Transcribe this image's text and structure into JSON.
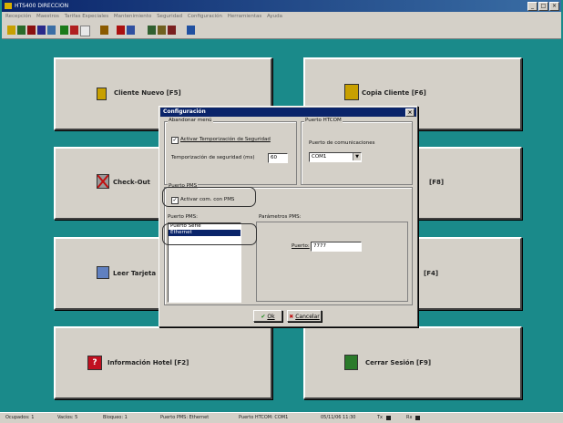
{
  "window": {
    "title": "HTS400 DIRECCION",
    "buttons": [
      "_",
      "□",
      "×"
    ]
  },
  "menu": [
    "Recepción",
    "Maestros",
    "Tarifas Especiales",
    "Mantenimiento",
    "Seguridad",
    "Configuración",
    "Herramientas",
    "Ayuda"
  ],
  "tiles": {
    "cliente_nuevo": "Cliente Nuevo   [F5]",
    "copia_cliente": "Copia Cliente   [F6]",
    "check_out": "Check-Out",
    "f8": "[F8]",
    "leer_tarjeta": "Leer Tarjeta",
    "f4": "[F4]",
    "informacion_hotel": "Información Hotel   [F2]",
    "cerrar_sesion": "Cerrar Sesión   [F9]"
  },
  "dialog": {
    "title": "Configuración",
    "close": "×",
    "abandonar": {
      "label": "Abandonar menú",
      "checkbox_label": "Activar Temporización de Seguridad",
      "timeout_label": "Temporización de seguridad (ms)",
      "timeout_value": "60"
    },
    "htcom": {
      "label": "Puerto HTCOM",
      "port_label": "Puerto de comunicaciones",
      "port_value": "COM1"
    },
    "pms": {
      "label": "Puerto PMS",
      "checkbox_label": "Activar com. con PMS",
      "ports_label": "Puerto PMS:",
      "ports": [
        "Puerto Serie",
        "Ethernet"
      ],
      "params_label": "Parámetros PMS:",
      "puerto_label": "Puerto:",
      "puerto_value": "7777"
    },
    "ok": "Ok",
    "cancel": "Cancelar"
  },
  "statusbar": {
    "s1": "Ocupados: 1",
    "s2": "Vacíos: 5",
    "s3": "Bloqueo: 1",
    "s4": "Puerto PMS: Ethernet",
    "s5": "Puerto HTCOM: COM1",
    "s6": "05/11/06  11:30",
    "s7": "Tx",
    "s8": "Rx"
  },
  "colors": {
    "desktop": "#1a8a8a",
    "face": "#d4d0c8",
    "title": "#0a246a",
    "selection": "#0a246a"
  }
}
